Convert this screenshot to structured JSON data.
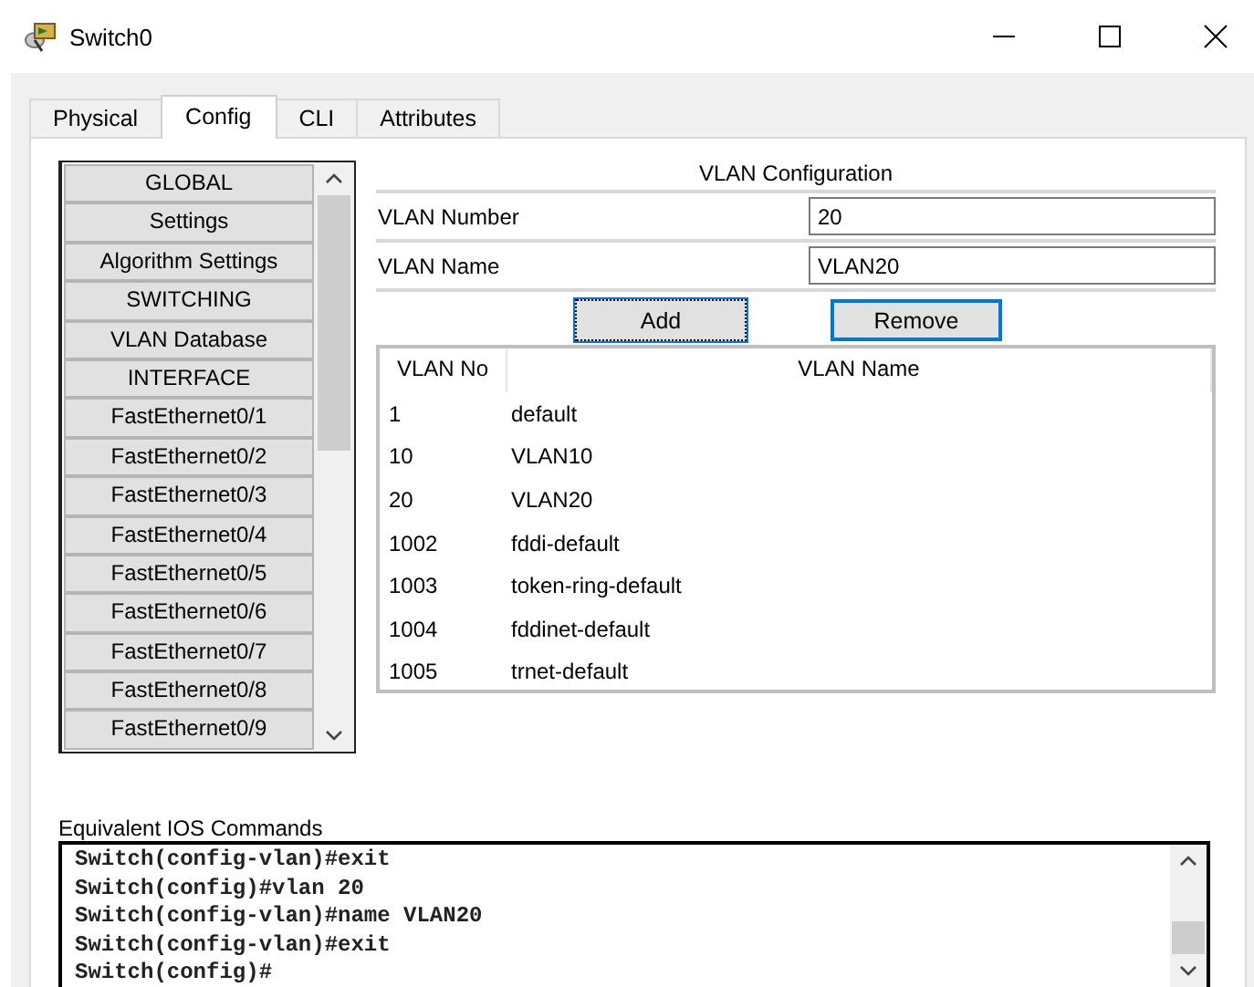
{
  "window": {
    "title": "Switch0"
  },
  "tabs": [
    {
      "label": "Physical",
      "selected": false
    },
    {
      "label": "Config",
      "selected": true
    },
    {
      "label": "CLI",
      "selected": false
    },
    {
      "label": "Attributes",
      "selected": false
    }
  ],
  "sidebar": {
    "items": [
      "GLOBAL",
      "Settings",
      "Algorithm Settings",
      "SWITCHING",
      "VLAN Database",
      "INTERFACE",
      "FastEthernet0/1",
      "FastEthernet0/2",
      "FastEthernet0/3",
      "FastEthernet0/4",
      "FastEthernet0/5",
      "FastEthernet0/6",
      "FastEthernet0/7",
      "FastEthernet0/8",
      "FastEthernet0/9"
    ]
  },
  "vlan_configuration": {
    "title": "VLAN Configuration",
    "fields": [
      {
        "label": "VLAN Number",
        "value": "20"
      },
      {
        "label": "VLAN Name",
        "value": "VLAN20"
      }
    ],
    "buttons": [
      "Add",
      "Remove"
    ],
    "table": {
      "columns": [
        "VLAN No",
        "VLAN Name"
      ],
      "rows": [
        [
          "1",
          "default"
        ],
        [
          "10",
          "VLAN10"
        ],
        [
          "20",
          "VLAN20"
        ],
        [
          "1002",
          "fddi-default"
        ],
        [
          "1003",
          "token-ring-default"
        ],
        [
          "1004",
          "fddinet-default"
        ],
        [
          "1005",
          "trnet-default"
        ]
      ]
    }
  },
  "ios_commands": {
    "label": "Equivalent IOS Commands",
    "lines": [
      "Switch(config-vlan)#exit",
      "Switch(config)#vlan 20",
      "Switch(config-vlan)#name VLAN20",
      "Switch(config-vlan)#exit",
      "Switch(config)#"
    ]
  }
}
